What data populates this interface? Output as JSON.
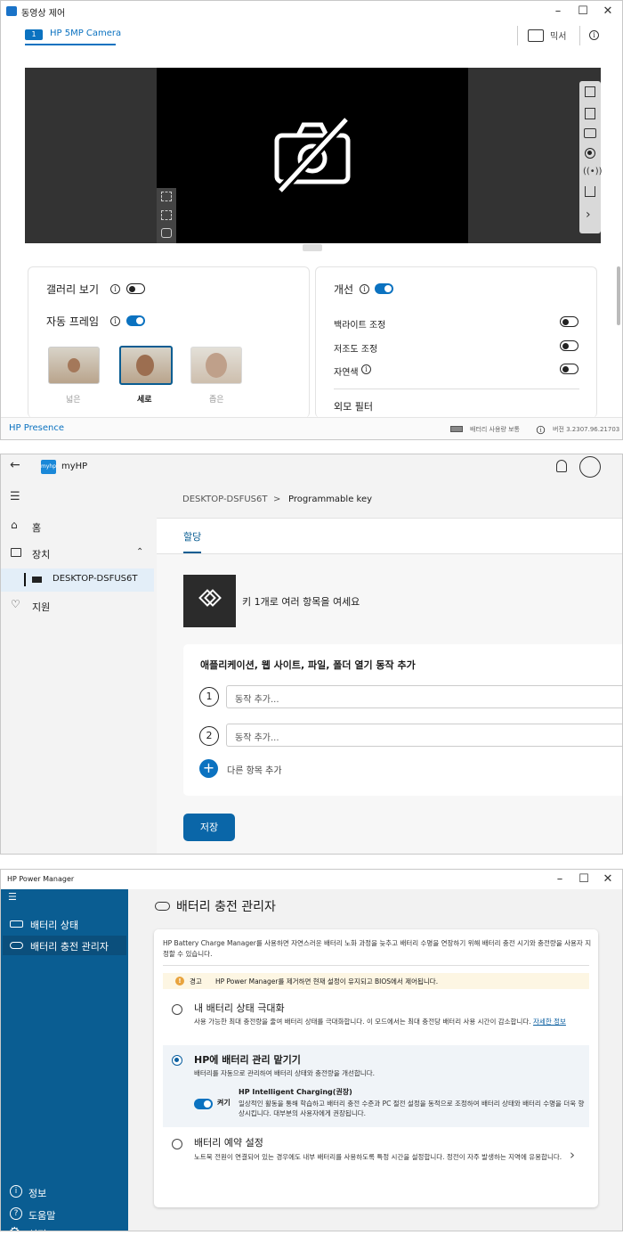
{
  "camera_window": {
    "title": "동영상 제어",
    "tab_number": "1",
    "tab_label": "HP 5MP Camera",
    "mixer_label": "믹서",
    "gallery_label": "갤러리 보기",
    "autoframe_label": "자동 프레임",
    "frame_options": [
      "넓은",
      "세로",
      "좁은"
    ],
    "enhance_label": "개선",
    "backlight_label": "백라이트 조정",
    "lowlight_label": "저조도 조정",
    "natural_color_label": "자연색",
    "appearance_filter_label": "외모 필터",
    "status_app": "HP Presence",
    "status_battery": "배터리 사용량 보통",
    "status_version": "버전 3.2307.96.21703",
    "toggles": {
      "gallery": "off",
      "autoframe": "on",
      "enhance": "on",
      "backlight": "off",
      "lowlight": "off",
      "natural_color": "off"
    }
  },
  "myhp_window": {
    "logo_text": "myhp",
    "app_title": "myHP",
    "nav": {
      "home": "홈",
      "devices": "장치",
      "device_item": "DESKTOP-DSFUS6T",
      "support": "지원"
    },
    "breadcrumb_device": "DESKTOP-DSFUS6T",
    "breadcrumb_separator": ">",
    "breadcrumb_page": "Programmable key",
    "tab_assign": "할당",
    "key_description": "키 1개로 여러 항목을 여세요",
    "actions_heading": "애플리케이션, 웹 사이트, 파일, 폴더 열기 동작 추가",
    "actions": [
      {
        "number": "1",
        "placeholder": "동작 추가..."
      },
      {
        "number": "2",
        "placeholder": "동작 추가..."
      }
    ],
    "add_more": "다른 항목 추가",
    "save": "저장"
  },
  "power_window": {
    "title": "HP Power Manager",
    "nav": {
      "battery_status": "배터리 상태",
      "charge_manager": "배터리 충전 관리자",
      "info": "정보",
      "help": "도움말",
      "settings": "설정"
    },
    "page_title": "배터리 충전 관리자",
    "intro": "HP Battery Charge Manager를 사용하면 자연스러운 배터리 노화 과정을 늦추고 배터리 수명을 연장하기 위해 배터리 충전 시기와 충전량을 사용자 지정할 수 있습니다.",
    "warning_label": "경고",
    "warning_text": "HP Power Manager를 제거하면 현재 설정이 유지되고 BIOS에서 제어됩니다.",
    "options": [
      {
        "title": "내 배터리 상태 극대화",
        "desc": "사용 가능한 최대 충전량을 줄여 배터리 상태를 극대화합니다. 이 모드에서는 최대 충전당 배터리 사용 시간이 감소합니다.",
        "link": "자세한 정보",
        "selected": false
      },
      {
        "title": "HP에 배터리 관리 맡기기",
        "desc": "배터리를 자동으로 관리하여 배터리 상태와 충전량을 개선합니다.",
        "selected": true
      },
      {
        "title": "배터리 예약 설정",
        "desc": "노트북 전원이 연결되어 있는 경우에도 내부 배터리를 사용하도록 특정 시간을 설정합니다. 정전이 자주 발생하는 지역에 유용합니다.",
        "selected": false
      }
    ],
    "intelligent_toggle_label": "켜기",
    "intelligent_title": "HP Intelligent Charging(권장)",
    "intelligent_desc": "일상적인 활동을 통해 학습하고 배터리 충전 수준과 PC 절전 설정을 동적으로 조정하여 배터리 상태와 배터리 수명을 더욱 향상시킵니다. 대부분의 사용자에게 권장됩니다.",
    "colors": {
      "sidebar": "#0a5d92",
      "accent": "#0b72c0"
    }
  }
}
